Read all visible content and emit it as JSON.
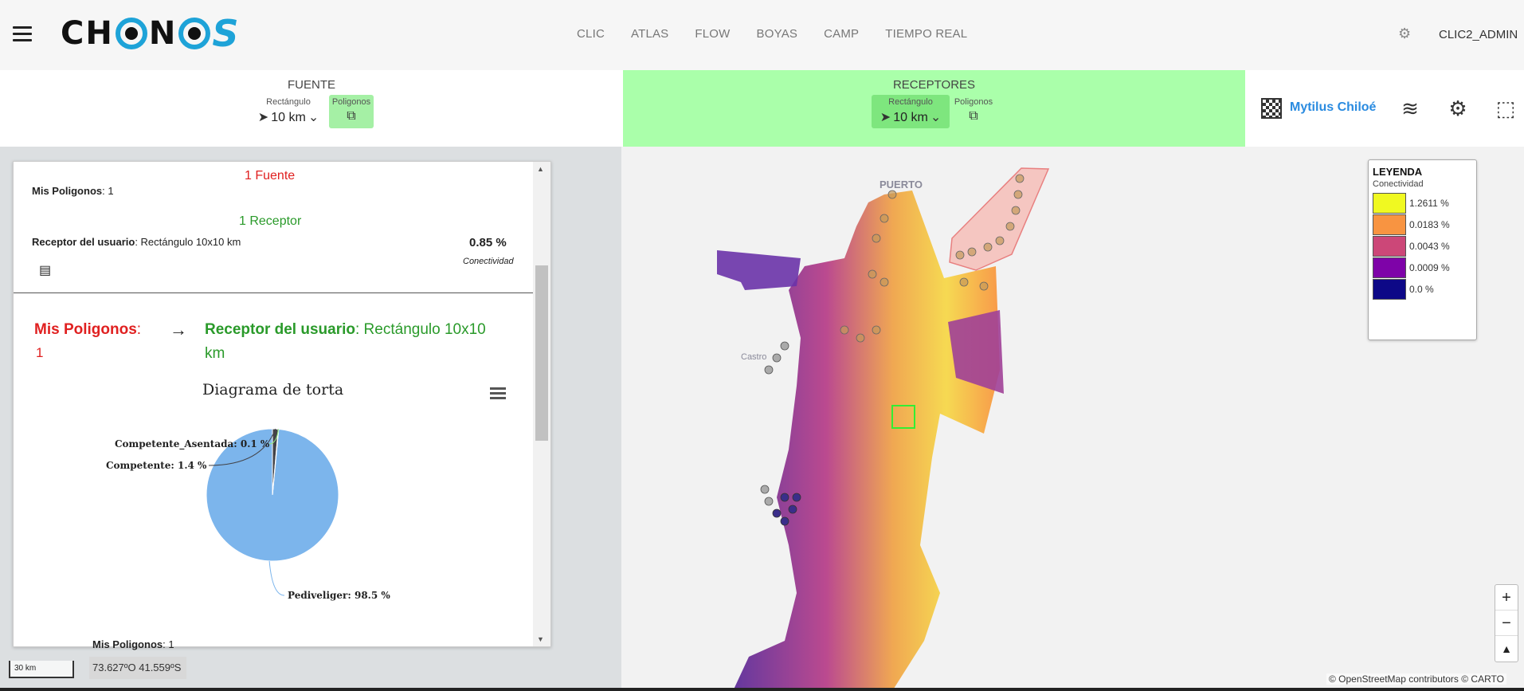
{
  "header": {
    "logo_text": "CHONOS",
    "nav": [
      "CLIC",
      "ATLAS",
      "FLOW",
      "BOYAS",
      "CAMP",
      "TIEMPO REAL"
    ],
    "user": "CLIC2_ADMIN"
  },
  "source": {
    "title": "FUENTE",
    "rect_label": "Rectángulo",
    "rect_value": "10 km",
    "poly_label": "Poligonos",
    "active": "poligonos"
  },
  "receptor": {
    "title": "RECEPTORES",
    "rect_label": "Rectángulo",
    "rect_value": "10 km",
    "poly_label": "Poligonos",
    "active": "rectangulo",
    "bg_color": "#aaffaa"
  },
  "project": {
    "name": "Mytilus Chiloé",
    "name_color": "#2a8be0"
  },
  "panel": {
    "fuente_heading": "1 Fuente",
    "mis_poligonos_label": "Mis Poligonos",
    "mis_poligonos_value": ": 1",
    "receptor_heading": "1 Receptor",
    "receptor_label": "Receptor del usuario",
    "receptor_value": ": Rectángulo 10x10 km",
    "conectividad_value": "0.85 %",
    "conectividad_label": "Conectividad",
    "flow_src_label": "Mis Poligonos",
    "flow_src_value": ":",
    "flow_src_count": "1",
    "arrow": "→",
    "flow_dst_label": "Receptor del usuario",
    "flow_dst_value": ": Rectángulo 10x10",
    "flow_dst_value2": "km",
    "bottom_label": "Mis Poligonos",
    "bottom_value": ": 1"
  },
  "chart_data": {
    "type": "pie",
    "title": "Diagrama de torta",
    "categories": [
      "Pediveliger",
      "Competente",
      "Competente_Asentada"
    ],
    "values": [
      98.5,
      1.4,
      0.1
    ],
    "labels": [
      "Pediveliger: 98.5 %",
      "Competente: 1.4 %",
      "Competente_Asentada: 0.1 %"
    ],
    "colors": [
      "#7cb5ec",
      "#434348",
      "#90ed7d"
    ]
  },
  "legend": {
    "title": "LEYENDA",
    "subtitle": "Conectividad",
    "items": [
      {
        "label": "1.2611 %",
        "color": "#f0f921"
      },
      {
        "label": "0.0183 %",
        "color": "#f89441"
      },
      {
        "label": "0.0043 %",
        "color": "#cc4778"
      },
      {
        "label": "0.0009 %",
        "color": "#7e03a8"
      },
      {
        "label": "0.0 %",
        "color": "#0d0887"
      }
    ]
  },
  "map": {
    "place_puerto": "PUERTO",
    "place_castro": "Castro",
    "scale": "30 km",
    "coords": "73.627ºO 41.559ºS",
    "attribution": "© OpenStreetMap contributors © CARTO",
    "zoom_in": "+",
    "zoom_out": "−",
    "north": "▲"
  }
}
